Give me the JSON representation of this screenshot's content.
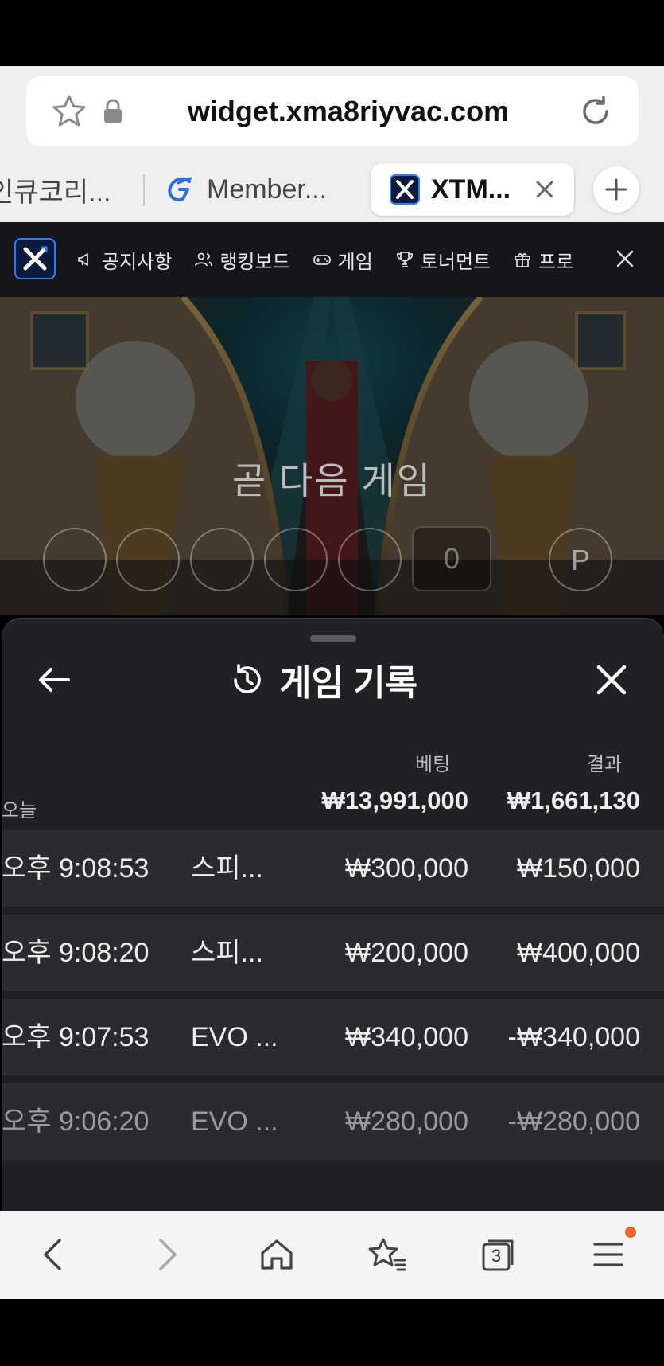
{
  "browser": {
    "url": "widget.xma8riyvac.com",
    "tabs": [
      {
        "label": "인큐코리..."
      },
      {
        "label": "Member..."
      },
      {
        "label": "XTM..."
      }
    ],
    "tab_count": "3"
  },
  "site_nav": {
    "items": [
      {
        "label": "공지사항",
        "icon": "megaphone-icon"
      },
      {
        "label": "랭킹보드",
        "icon": "users-icon"
      },
      {
        "label": "게임",
        "icon": "gamepad-icon"
      },
      {
        "label": "토너먼트",
        "icon": "trophy-icon"
      },
      {
        "label": "프로",
        "icon": "gift-icon"
      }
    ]
  },
  "video": {
    "status": "곧 다음 게임",
    "zero_label": "0",
    "p_label": "P"
  },
  "history": {
    "title": "게임 기록",
    "header_bet": "베팅",
    "header_result": "결과",
    "today_label": "오늘",
    "total_bet": "₩13,991,000",
    "total_result": "₩1,661,130",
    "rows": [
      {
        "time": "오후 9:08:53",
        "game": "스피...",
        "bet": "₩300,000",
        "result": "₩150,000"
      },
      {
        "time": "오후 9:08:20",
        "game": "스피...",
        "bet": "₩200,000",
        "result": "₩400,000"
      },
      {
        "time": "오후 9:07:53",
        "game": "EVO ...",
        "bet": "₩340,000",
        "result": "-₩340,000"
      },
      {
        "time": "오후 9:06:20",
        "game": "EVO ...",
        "bet": "₩280,000",
        "result": "-₩280,000"
      }
    ]
  },
  "colors": {
    "sheet_bg": "#202124",
    "row_bg": "#2a2b2e",
    "nav_bg": "#14161c",
    "brand_blue": "#2f7ef7",
    "notification_dot": "#f0662d"
  }
}
